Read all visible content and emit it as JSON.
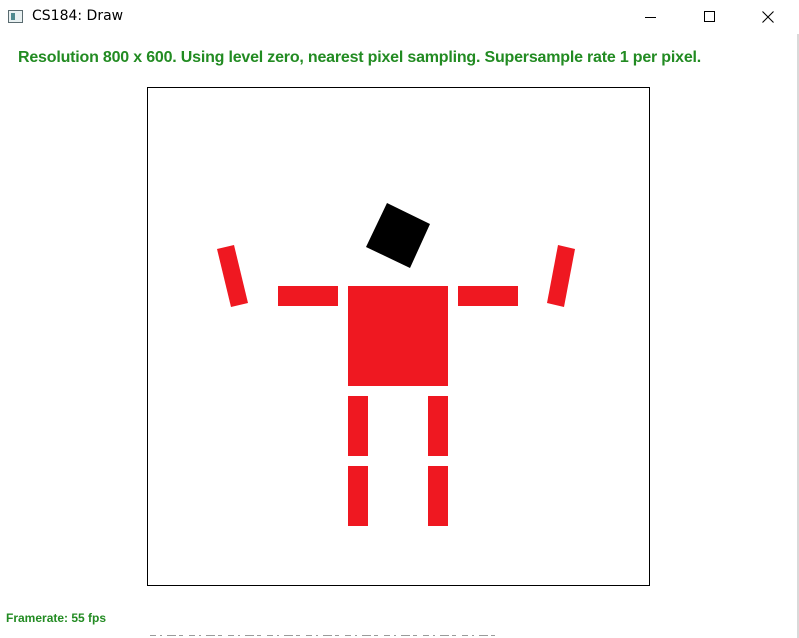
{
  "window": {
    "title": "CS184: Draw",
    "icon": "app-window-icon",
    "controls": [
      "minimize-icon",
      "maximize-icon",
      "close-icon"
    ]
  },
  "status": {
    "text": "Resolution 800 x 600. Using level zero, nearest pixel sampling. Supersample rate 1 per pixel.",
    "color": "#228b22"
  },
  "footer": {
    "framerate": "Framerate: 55 fps"
  },
  "figure": {
    "head_color": "#000000",
    "body_color": "#ef1821",
    "parts": [
      "head",
      "torso",
      "left-upper-arm",
      "left-forearm",
      "right-upper-arm",
      "right-forearm",
      "left-thigh",
      "left-shin",
      "right-thigh",
      "right-shin"
    ]
  }
}
